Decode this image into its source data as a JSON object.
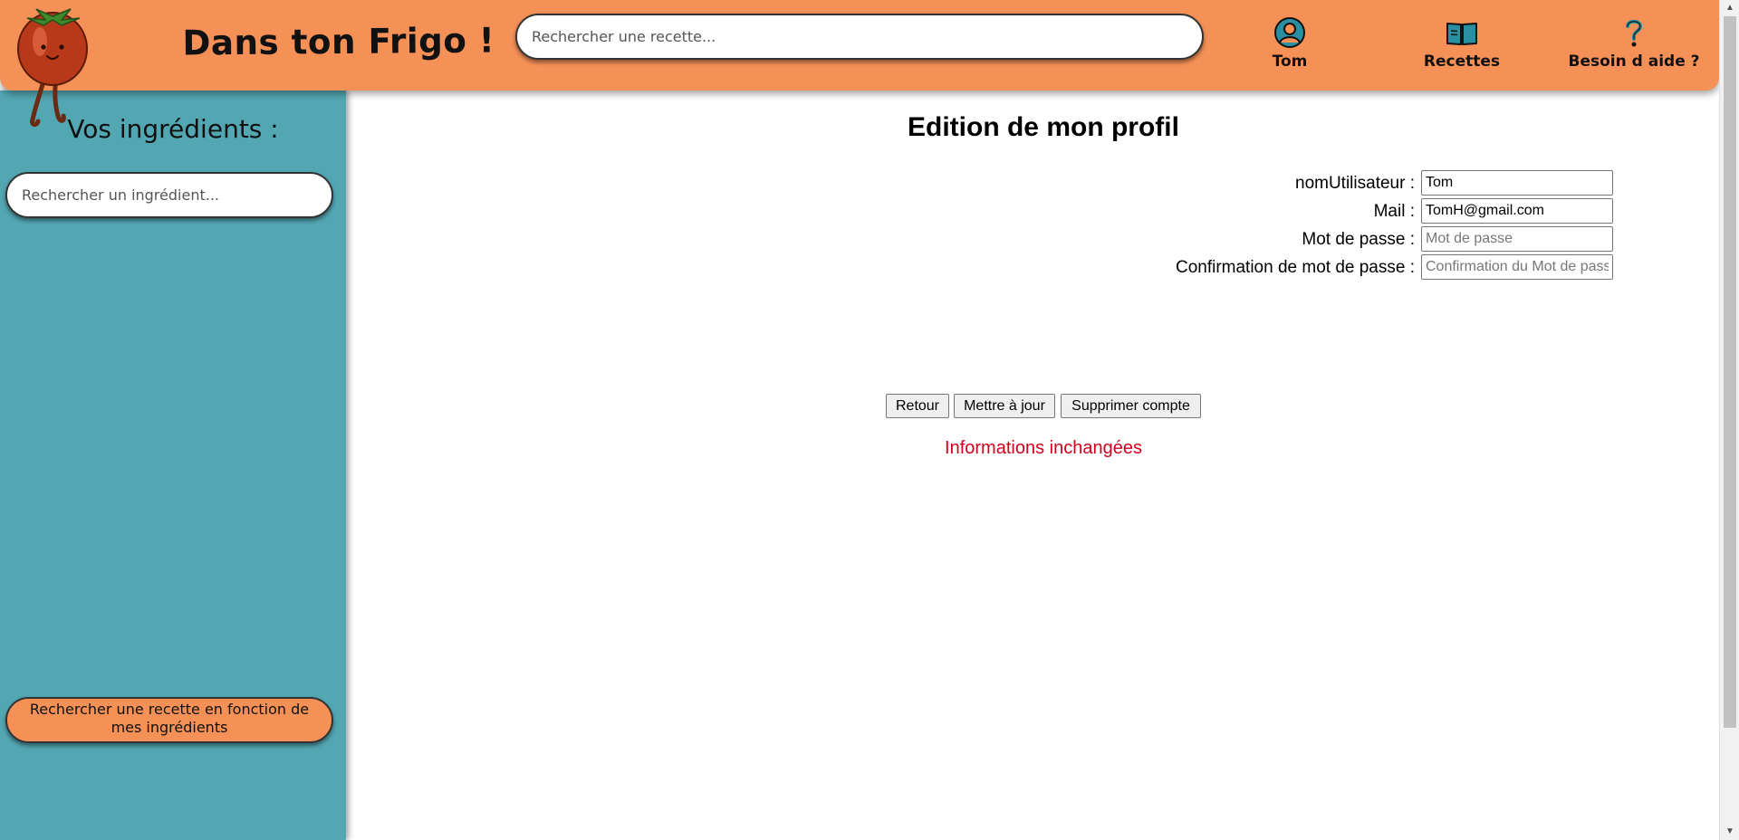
{
  "header": {
    "site_title": "Dans ton Frigo !",
    "recipe_search_placeholder": "Rechercher une recette...",
    "nav": [
      {
        "label": "Tom",
        "icon": "user-icon"
      },
      {
        "label": "Recettes",
        "icon": "book-icon"
      },
      {
        "label": "Besoin d aide ?",
        "icon": "question-icon"
      }
    ],
    "colors": {
      "header_bg": "#f59157",
      "sidebar_bg": "#53a7b3",
      "accent": "#2a8fa0"
    }
  },
  "sidebar": {
    "title": "Vos ingrédients :",
    "ingredient_search_placeholder": "Rechercher un ingrédient...",
    "search_button_label": "Rechercher une recette en fonction de mes ingrédients"
  },
  "main": {
    "title": "Edition de mon profil",
    "form": {
      "username_label": "nomUtilisateur :",
      "username_value": "Tom",
      "mail_label": "Mail :",
      "mail_value": "TomH@gmail.com",
      "password_label": "Mot de passe :",
      "password_placeholder": "Mot de passe",
      "confirm_label": "Confirmation de mot de passe :",
      "confirm_placeholder": "Confirmation du Mot de passe"
    },
    "buttons": {
      "back": "Retour",
      "update": "Mettre à jour",
      "delete": "Supprimer compte"
    },
    "status_message": "Informations inchangées",
    "status_color": "#d0021b"
  }
}
